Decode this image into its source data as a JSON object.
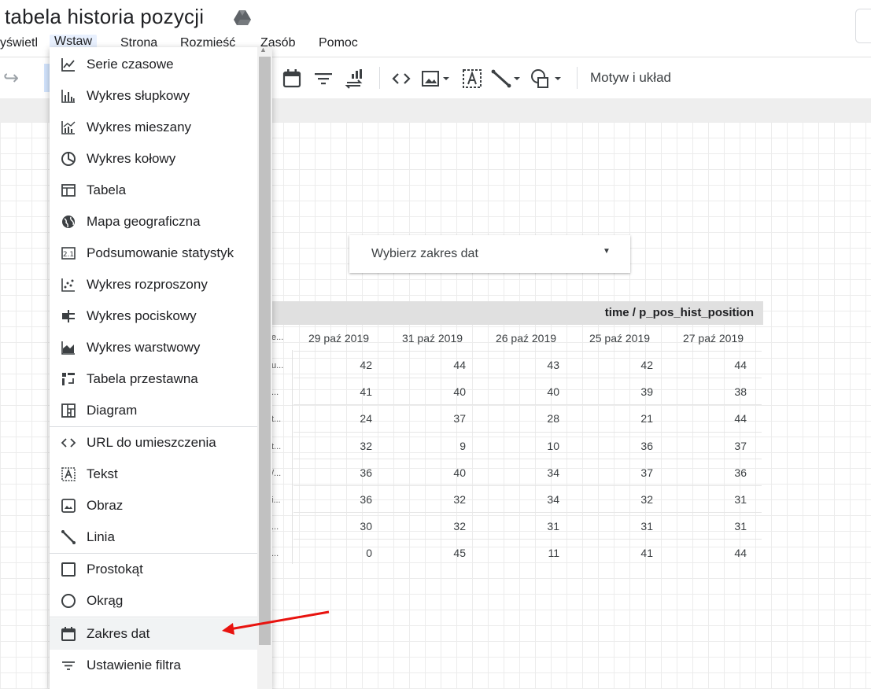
{
  "app": {
    "title": "tabela historia pozycji"
  },
  "menubar": {
    "items": [
      {
        "label": "yświetl"
      },
      {
        "label": "Wstaw"
      },
      {
        "label": "Strona"
      },
      {
        "label": "Rozmieść"
      },
      {
        "label": "Zasób"
      },
      {
        "label": "Pomoc"
      }
    ]
  },
  "toolbar": {
    "theme_label": "Motyw i układ",
    "icons": [
      "redo-icon",
      "calendar-icon",
      "filter-icon",
      "sort-icon",
      "embed-code-icon",
      "image-icon",
      "text-icon",
      "line-icon",
      "shape-icon"
    ]
  },
  "date_control": {
    "label": "Wybierz zakres dat"
  },
  "table": {
    "header_title": "time / p_pos_hist_position",
    "first_col_header": "e...",
    "columns": [
      "29 paź 2019",
      "31 paź 2019",
      "26 paź 2019",
      "25 paź 2019",
      "27 paź 2019"
    ],
    "rows": [
      {
        "first": "u...",
        "values": [
          "42",
          "44",
          "43",
          "42",
          "44"
        ]
      },
      {
        "first": "...",
        "values": [
          "41",
          "40",
          "40",
          "39",
          "38"
        ]
      },
      {
        "first": "t...",
        "values": [
          "24",
          "37",
          "28",
          "21",
          "44"
        ]
      },
      {
        "first": "t...",
        "values": [
          "32",
          "9",
          "10",
          "36",
          "37"
        ]
      },
      {
        "first": "/...",
        "values": [
          "36",
          "40",
          "34",
          "37",
          "36"
        ]
      },
      {
        "first": "i...",
        "values": [
          "36",
          "32",
          "34",
          "32",
          "31"
        ]
      },
      {
        "first": "...",
        "values": [
          "30",
          "32",
          "31",
          "31",
          "31"
        ]
      },
      {
        "first": "...",
        "values": [
          "0",
          "45",
          "11",
          "41",
          "44"
        ]
      }
    ]
  },
  "insert_menu": {
    "items": [
      {
        "label": "Serie czasowe",
        "icon": "timeseries-icon"
      },
      {
        "label": "Wykres słupkowy",
        "icon": "bar-chart-icon"
      },
      {
        "label": "Wykres mieszany",
        "icon": "combo-chart-icon"
      },
      {
        "label": "Wykres kołowy",
        "icon": "pie-chart-icon"
      },
      {
        "label": "Tabela",
        "icon": "table-icon"
      },
      {
        "label": "Mapa geograficzna",
        "icon": "globe-icon"
      },
      {
        "label": "Podsumowanie statystyk",
        "icon": "scorecard-icon"
      },
      {
        "label": "Wykres rozproszony",
        "icon": "scatter-chart-icon"
      },
      {
        "label": "Wykres pociskowy",
        "icon": "bullet-chart-icon"
      },
      {
        "label": "Wykres warstwowy",
        "icon": "area-chart-icon"
      },
      {
        "label": "Tabela przestawna",
        "icon": "pivot-table-icon"
      },
      {
        "label": "Diagram",
        "icon": "treemap-icon"
      },
      {
        "label": "URL do umieszczenia",
        "icon": "embed-icon"
      },
      {
        "label": "Tekst",
        "icon": "text-box-icon"
      },
      {
        "label": "Obraz",
        "icon": "image-icon"
      },
      {
        "label": "Linia",
        "icon": "line-icon"
      },
      {
        "label": "Prostokąt",
        "icon": "rectangle-icon"
      },
      {
        "label": "Okrąg",
        "icon": "circle-icon"
      },
      {
        "label": "Zakres dat",
        "icon": "calendar-icon"
      },
      {
        "label": "Ustawienie filtra",
        "icon": "filter-icon"
      }
    ]
  },
  "colors": {
    "annotation_arrow": "#e8130f",
    "menu_highlight": "#f1f3f4",
    "active_menu": "#e8f0fe"
  }
}
